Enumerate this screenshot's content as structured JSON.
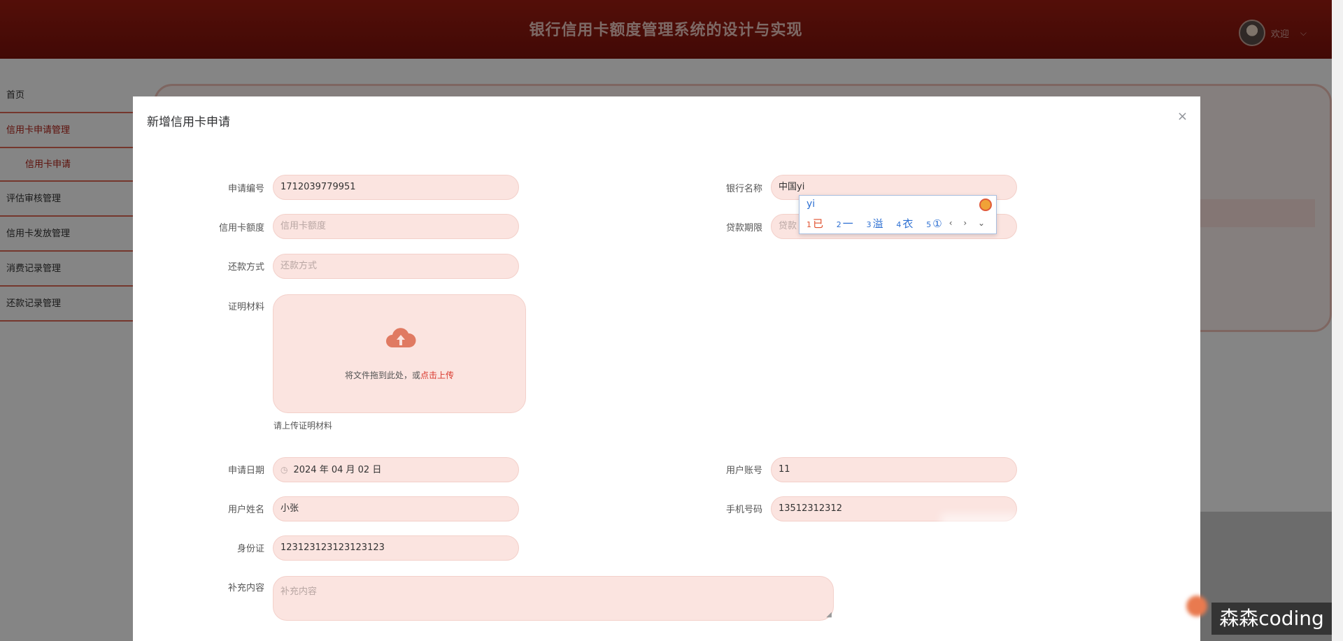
{
  "header": {
    "title": "银行信用卡额度管理系统的设计与实现",
    "welcome": "欢迎"
  },
  "sidebar": {
    "items": [
      {
        "label": "首页"
      },
      {
        "label": "信用卡申请管理"
      },
      {
        "label": "信用卡申请"
      },
      {
        "label": "评估审核管理"
      },
      {
        "label": "信用卡发放管理"
      },
      {
        "label": "消费记录管理"
      },
      {
        "label": "还款记录管理"
      }
    ]
  },
  "dialog": {
    "title": "新增信用卡申请",
    "close": "×",
    "fields": {
      "apply_no": {
        "label": "申请编号",
        "value": "1712039779951"
      },
      "bank_name": {
        "label": "银行名称",
        "value": "中国yi"
      },
      "credit_limit": {
        "label": "信用卡额度",
        "placeholder": "信用卡额度"
      },
      "loan_term": {
        "label": "贷款期限",
        "placeholder": "贷款"
      },
      "repay_method": {
        "label": "还款方式",
        "placeholder": "还款方式"
      },
      "proof": {
        "label": "证明材料",
        "upload_text": "将文件拖到此处，或",
        "upload_link": "点击上传",
        "tip": "请上传证明材料"
      },
      "apply_date": {
        "label": "申请日期",
        "value": "2024 年 04 月 02 日"
      },
      "user_account": {
        "label": "用户账号",
        "value": "11"
      },
      "user_name": {
        "label": "用户姓名",
        "value": "小张"
      },
      "phone": {
        "label": "手机号码",
        "value": "13512312312"
      },
      "id_card": {
        "label": "身份证",
        "value": "123123123123123123"
      },
      "extra": {
        "label": "补充内容",
        "placeholder": "补充内容"
      }
    }
  },
  "ime": {
    "composition": "yi",
    "candidates": [
      {
        "num": "1",
        "text": "已"
      },
      {
        "num": "2",
        "text": "一"
      },
      {
        "num": "3",
        "text": "溢"
      },
      {
        "num": "4",
        "text": "衣"
      },
      {
        "num": "5",
        "text": "①"
      }
    ],
    "nav": "‹ › ⌄"
  },
  "watermark": "森森coding"
}
